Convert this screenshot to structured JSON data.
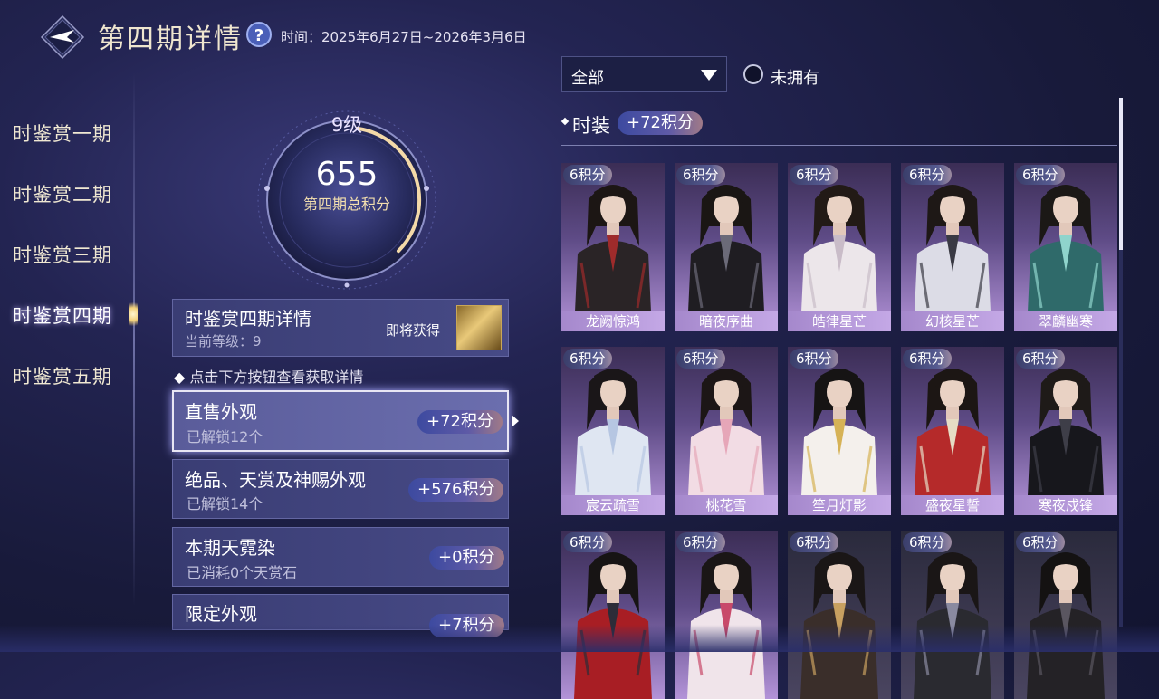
{
  "header": {
    "title": "第四期详情",
    "help_icon": "question-icon",
    "time_text": "时间：2025年6月27日~2026年3月6日"
  },
  "nav": {
    "items": [
      {
        "label": "时鉴赏一期",
        "active": false
      },
      {
        "label": "时鉴赏二期",
        "active": false
      },
      {
        "label": "时鉴赏三期",
        "active": false
      },
      {
        "label": "时鉴赏四期",
        "active": true
      },
      {
        "label": "时鉴赏五期",
        "active": false
      }
    ]
  },
  "progress": {
    "level_text": "9级",
    "total_score": "655",
    "score_label": "第四期总积分",
    "ring_fill_fraction": 0.35
  },
  "details_panel": {
    "title": "时鉴赏四期详情",
    "current_level": "当前等级：9",
    "obtain_label": "即将获得"
  },
  "hint": "点击下方按钮查看获取详情",
  "categories": [
    {
      "title": "直售外观",
      "sub": "已解锁12个",
      "badge": "+72积分",
      "selected": true
    },
    {
      "title": "绝品、天赏及神赐外观",
      "sub": "已解锁14个",
      "badge": "+576积分",
      "selected": false
    },
    {
      "title": "本期天霓染",
      "sub": "已消耗0个天赏石",
      "badge": "+0积分",
      "selected": false
    },
    {
      "title": "限定外观",
      "sub": "",
      "badge": "+7积分",
      "selected": false
    }
  ],
  "filter": {
    "dropdown_value": "全部",
    "unowned_label": "未拥有",
    "unowned_checked": false
  },
  "section": {
    "title": "时装",
    "badge": "+72积分"
  },
  "outfits": [
    {
      "points": "6积分",
      "name": "龙阙惊鸿",
      "tone": "purple",
      "hair": "#1c1614",
      "cloth": "#2a2426",
      "accent": "#9e2b2b"
    },
    {
      "points": "6积分",
      "name": "暗夜序曲",
      "tone": "purple",
      "hair": "#1a1614",
      "cloth": "#1f1d22",
      "accent": "#6b6a78"
    },
    {
      "points": "6积分",
      "name": "皓律星芒",
      "tone": "purple",
      "hair": "#221a16",
      "cloth": "#ece6ea",
      "accent": "#c9bcc8"
    },
    {
      "points": "6积分",
      "name": "幻核星芒",
      "tone": "purple",
      "hair": "#1e1816",
      "cloth": "#dcdce6",
      "accent": "#3a3a44"
    },
    {
      "points": "6积分",
      "name": "翠麟幽寒",
      "tone": "purple",
      "hair": "#1b1816",
      "cloth": "#2f6a6a",
      "accent": "#8fd4cc"
    },
    {
      "points": "6积分",
      "name": "宸云疏雪",
      "tone": "purple",
      "hair": "#1a1618",
      "cloth": "#dfe6f2",
      "accent": "#b6c6e2"
    },
    {
      "points": "6积分",
      "name": "桃花雪",
      "tone": "purple",
      "hair": "#1c1616",
      "cloth": "#f2dce4",
      "accent": "#e6a6b8"
    },
    {
      "points": "6积分",
      "name": "笙月灯影",
      "tone": "purple",
      "hair": "#161414",
      "cloth": "#f4f0ec",
      "accent": "#d6b256"
    },
    {
      "points": "6积分",
      "name": "盛夜星誓",
      "tone": "purple",
      "hair": "#1c1614",
      "cloth": "#b52a2a",
      "accent": "#e6dcc4"
    },
    {
      "points": "6积分",
      "name": "寒夜戍锋",
      "tone": "purple",
      "hair": "#1e1a18",
      "cloth": "#17171c",
      "accent": "#3e3e48"
    },
    {
      "points": "6积分",
      "name": "",
      "tone": "purple",
      "hair": "#171414",
      "cloth": "#a81e24",
      "accent": "#2c2c38"
    },
    {
      "points": "6积分",
      "name": "",
      "tone": "purple",
      "hair": "#1a1616",
      "cloth": "#f0e4ea",
      "accent": "#c84a6a"
    },
    {
      "points": "6积分",
      "name": "",
      "tone": "dark",
      "hair": "#1a1616",
      "cloth": "#3a2e2a",
      "accent": "#c8a060"
    },
    {
      "points": "6积分",
      "name": "",
      "tone": "dark",
      "hair": "#1a1616",
      "cloth": "#2a2a30",
      "accent": "#8a8aa0"
    },
    {
      "points": "6积分",
      "name": "",
      "tone": "dark",
      "hair": "#141212",
      "cloth": "#242226",
      "accent": "#5a5660"
    }
  ],
  "icons": {
    "back": "back-arrow-icon",
    "dropdown": "triangle-down-icon",
    "radio": "radio-circle-icon",
    "reward": "golden-reward-item-icon"
  }
}
